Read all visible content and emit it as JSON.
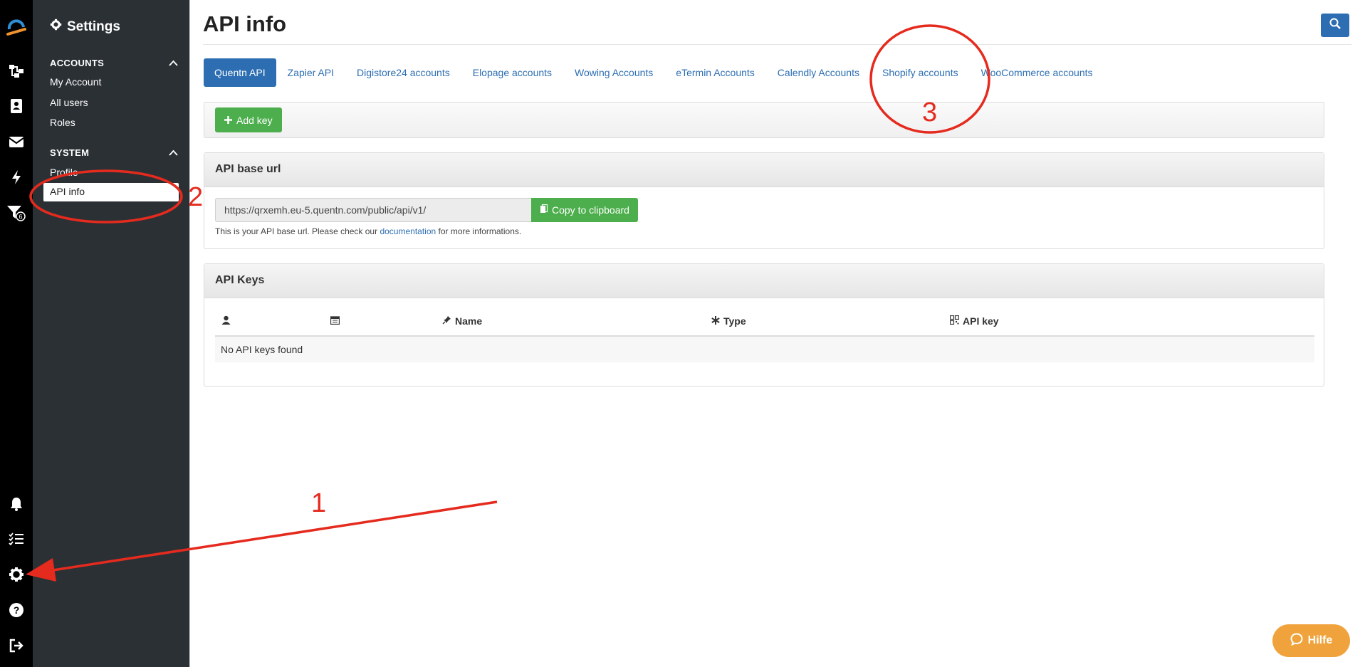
{
  "rail": {
    "icons": [
      "logo-icon",
      "flow-icon",
      "contacts-icon",
      "mail-icon",
      "lightning-icon",
      "filter-icon",
      "bell-icon",
      "checklist-icon",
      "gear-icon",
      "help-icon",
      "logout-icon"
    ],
    "filter_badge": "6"
  },
  "sidebar": {
    "title": "Settings",
    "sections": [
      {
        "label": "ACCOUNTS",
        "items": [
          "My Account",
          "All users",
          "Roles"
        ]
      },
      {
        "label": "SYSTEM",
        "items": [
          "Profile",
          "API info"
        ]
      }
    ],
    "active_item": "API info"
  },
  "page": {
    "title": "API info"
  },
  "tabs": [
    "Quentn API",
    "Zapier API",
    "Digistore24 accounts",
    "Elopage accounts",
    "Wowing Accounts",
    "eTermin Accounts",
    "Calendly Accounts",
    "Shopify accounts",
    "WooCommerce accounts"
  ],
  "active_tab": "Quentn API",
  "toolbar": {
    "add_key_label": "Add key"
  },
  "base_url": {
    "heading": "API base url",
    "url": "https://qrxemh.eu-5.quentn.com/public/api/v1/",
    "copy_label": "Copy to clipboard",
    "hint_before": "This is your API base url. Please check our ",
    "hint_link": "documentation",
    "hint_after": " for more informations."
  },
  "keys": {
    "heading": "API Keys",
    "columns": [
      "",
      "",
      "Name",
      "Type",
      "API key"
    ],
    "column_icons": [
      "user-icon",
      "calendar-icon",
      "pin-icon",
      "asterisk-icon",
      "qrcode-icon"
    ],
    "empty_text": "No API keys found"
  },
  "help_button": {
    "label": "Hilfe"
  },
  "annotations": {
    "one": "1",
    "two": "2",
    "three": "3"
  },
  "colors": {
    "accent_blue": "#2d6eb2",
    "green": "#4cae4c",
    "annotation_red": "#e52a1e",
    "sidebar": "#2b3035",
    "help_orange": "#f0a33c"
  }
}
